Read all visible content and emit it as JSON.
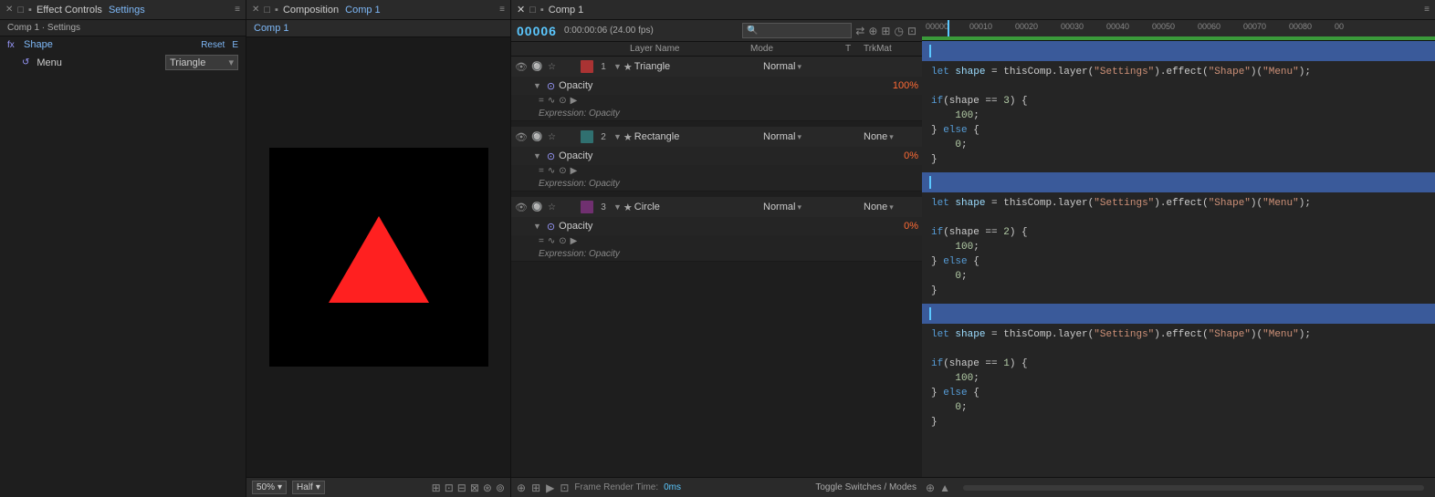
{
  "effectControls": {
    "panelTitle": "Effect Controls",
    "settingsLabel": "Settings",
    "subheader": "Comp 1 · Settings",
    "shape": {
      "fxLabel": "fx",
      "propName": "Shape",
      "resetLabel": "Reset",
      "eLabel": "E"
    },
    "menu": {
      "iconLabel": "↺",
      "label": "Menu",
      "value": "Triangle",
      "chevron": "▾"
    }
  },
  "composition": {
    "panelTitle": "Composition",
    "compName": "Comp 1",
    "subheader": "Comp 1",
    "zoomLevel": "50%",
    "quality": "Half",
    "footerIcons": [
      "⊞",
      "⊡",
      "⊟",
      "⊠",
      "⊛",
      "⊚",
      "⊙"
    ]
  },
  "timeline": {
    "panelTitle": "Comp 1",
    "timecode": "00006",
    "timecodeDetail": "0:00:00:06 (24.00 fps)",
    "searchPlaceholder": "",
    "ruler": {
      "marks": [
        "00000",
        "00010",
        "00020",
        "00030",
        "00040",
        "00050",
        "00060",
        "00070",
        "00080",
        "00"
      ]
    },
    "columns": {
      "layerName": "Layer Name",
      "mode": "Mode",
      "t": "T",
      "trkMat": "TrkMat"
    },
    "layers": [
      {
        "id": 1,
        "name": "Triangle",
        "labelColor": "red",
        "mode": "Normal",
        "opacity": "100%",
        "expression": "Expression: Opacity",
        "codeLine1": "let shape = thisComp.layer(\"Settings\").effect(\"Shape\")(\"Menu\");",
        "codeLine2": "",
        "codeIf": "if(shape == 3) {",
        "codeThen": "    100;",
        "codeElse": "} else {",
        "codeElseVal": "    0;",
        "codeEnd": "}",
        "hasTrkMat": false
      },
      {
        "id": 2,
        "name": "Rectangle",
        "labelColor": "teal",
        "mode": "Normal",
        "opacity": "0%",
        "expression": "Expression: Opacity",
        "codeLine1": "let shape = thisComp.layer(\"Settings\").effect(\"Shape\")(\"Menu\");",
        "codeLine2": "",
        "codeIf": "if(shape == 2) {",
        "codeThen": "    100;",
        "codeElse": "} else {",
        "codeElseVal": "    0;",
        "codeEnd": "}",
        "hasTrkMat": true,
        "trkMatValue": "None"
      },
      {
        "id": 3,
        "name": "Circle",
        "labelColor": "purple",
        "mode": "Normal",
        "opacity": "0%",
        "expression": "Expression: Opacity",
        "codeLine1": "let shape = thisComp.layer(\"Settings\").effect(\"Shape\")(\"Menu\");",
        "codeLine2": "",
        "codeIf": "if(shape == 1) {",
        "codeThen": "    100;",
        "codeElse": "} else {",
        "codeElseVal": "    0;",
        "codeEnd": "}",
        "hasTrkMat": true,
        "trkMatValue": "None"
      }
    ],
    "bottomBar": {
      "frameRenderLabel": "Frame Render Time:",
      "frameRenderValue": "0ms",
      "toggleLabel": "Toggle Switches / Modes"
    }
  }
}
